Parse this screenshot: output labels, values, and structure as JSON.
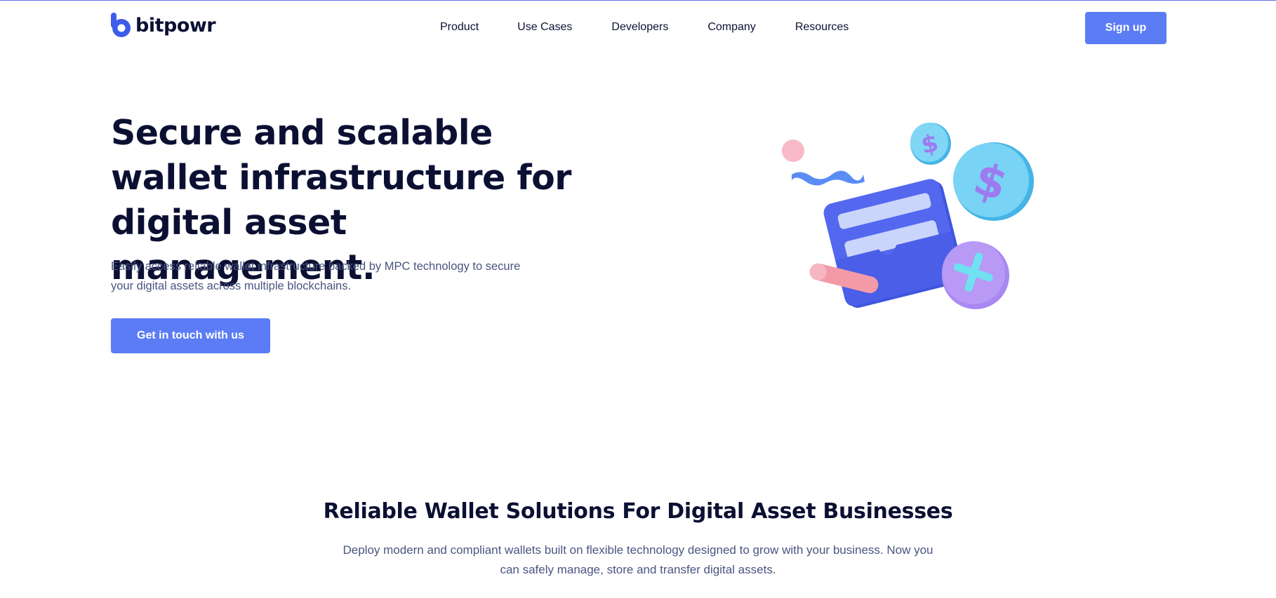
{
  "header": {
    "logo_text": "bitpowr",
    "nav": [
      "Product",
      "Use Cases",
      "Developers",
      "Company",
      "Resources"
    ],
    "signup_label": "Sign up"
  },
  "hero": {
    "title": "Secure and scalable wallet infrastructure for digital asset management.",
    "subtitle": "Easily access reliable wallet infrastructure backed by MPC technology to secure your digital assets across multiple blockchains.",
    "cta_label": "Get in touch with us"
  },
  "section": {
    "title": "Reliable Wallet Solutions For Digital Asset Businesses",
    "subtitle": "Deploy modern and compliant wallets built on flexible technology designed to grow with your business. Now you can safely manage, store and transfer digital assets."
  },
  "colors": {
    "accent": "#5b7cf4",
    "heading": "#0b1033",
    "body_text": "#4a5580"
  },
  "icons": {
    "logo": "bitpowr-b-logo",
    "illustration": "wallet-with-coins-illustration"
  }
}
